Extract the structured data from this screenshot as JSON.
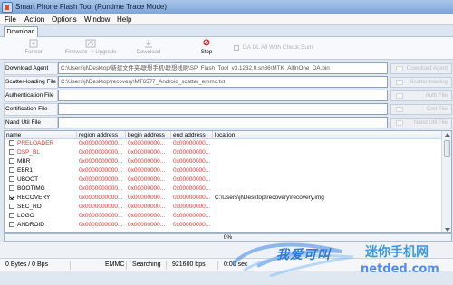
{
  "window": {
    "title": "Smart Phone Flash Tool (Runtime Trace Mode)"
  },
  "menu": [
    "File",
    "Action",
    "Options",
    "Window",
    "Help"
  ],
  "tabs": [
    {
      "label": "Download"
    }
  ],
  "toolbar": [
    {
      "label": "Format",
      "icon": "format-icon"
    },
    {
      "label": "Firmware -> Upgrade",
      "icon": "upgrade-icon"
    },
    {
      "label": "Download",
      "icon": "download-icon"
    },
    {
      "label": "Stop",
      "icon": "stop-icon"
    }
  ],
  "da_option": {
    "label": "DA DL All With Check Sum",
    "checked": false
  },
  "fields": [
    {
      "label": "Download Agent",
      "value": "C:\\Users\\jl\\Desktop\\新建文件夹\\联想手机\\联想线刷\\SP_Flash_Tool_v3.1232.0.sn36\\MTK_AllInOne_DA.bin",
      "button": "Download Agent"
    },
    {
      "label": "Scatter-loading File",
      "value": "C:\\Users\\jl\\Desktop\\recovery\\MT6577_Android_scatter_emmc.txt",
      "button": "Scatter-loading"
    },
    {
      "label": "Authentication File",
      "value": "",
      "button": "Auth File"
    },
    {
      "label": "Certification File",
      "value": "",
      "button": "Cert File"
    },
    {
      "label": "Nand Util File",
      "value": "",
      "button": "Nand Util File"
    }
  ],
  "table": {
    "headers": [
      "name",
      "region address",
      "begin address",
      "end address",
      "location"
    ],
    "rows": [
      {
        "checked": false,
        "name": "PRELOADER",
        "region": "0x0000000000...",
        "begin": "0x00000000...",
        "end": "0x00000000...",
        "location": "",
        "red": true
      },
      {
        "checked": false,
        "name": "DSP_BL",
        "region": "0x0000000000...",
        "begin": "0x00000000...",
        "end": "0x00000000...",
        "location": "",
        "red": true
      },
      {
        "checked": false,
        "name": "MBR",
        "region": "0x0000000000...",
        "begin": "0x00000000...",
        "end": "0x00000000...",
        "location": "",
        "red": false
      },
      {
        "checked": false,
        "name": "EBR1",
        "region": "0x0000000000...",
        "begin": "0x00000000...",
        "end": "0x00000000...",
        "location": "",
        "red": false
      },
      {
        "checked": false,
        "name": "UBOOT",
        "region": "0x0000000000...",
        "begin": "0x00000000...",
        "end": "0x00000000...",
        "location": "",
        "red": false
      },
      {
        "checked": false,
        "name": "BOOTIMG",
        "region": "0x0000000000...",
        "begin": "0x00000000...",
        "end": "0x00000000...",
        "location": "",
        "red": false
      },
      {
        "checked": true,
        "name": "RECOVERY",
        "region": "0x0000000000...",
        "begin": "0x00000000...",
        "end": "0x00000000...",
        "location": "C:\\Users\\jl\\Desktop\\recovery\\recovery.img",
        "red": false
      },
      {
        "checked": false,
        "name": "SEC_RO",
        "region": "0x0000000000...",
        "begin": "0x00000000...",
        "end": "0x00000000...",
        "location": "",
        "red": false
      },
      {
        "checked": false,
        "name": "LOGO",
        "region": "0x0000000000...",
        "begin": "0x00000000...",
        "end": "0x00000000...",
        "location": "",
        "red": false
      },
      {
        "checked": false,
        "name": "ANDROID",
        "region": "0x0000000000...",
        "begin": "0x00000000...",
        "end": "0x00000000...",
        "location": "",
        "red": false
      }
    ]
  },
  "progress": {
    "value": 0,
    "text": "0%"
  },
  "status": [
    "0 Bytes / 0 Bps",
    "EMMC",
    "Searching",
    "921600 bps",
    "0:00 sec"
  ],
  "watermark": {
    "logo": "我爱可叫",
    "site": "迷你手机网",
    "domain": "netded.com"
  },
  "colors": {
    "title": "#7ea4d8",
    "red": "#ee2d2d",
    "accent": "#8bd36f"
  }
}
